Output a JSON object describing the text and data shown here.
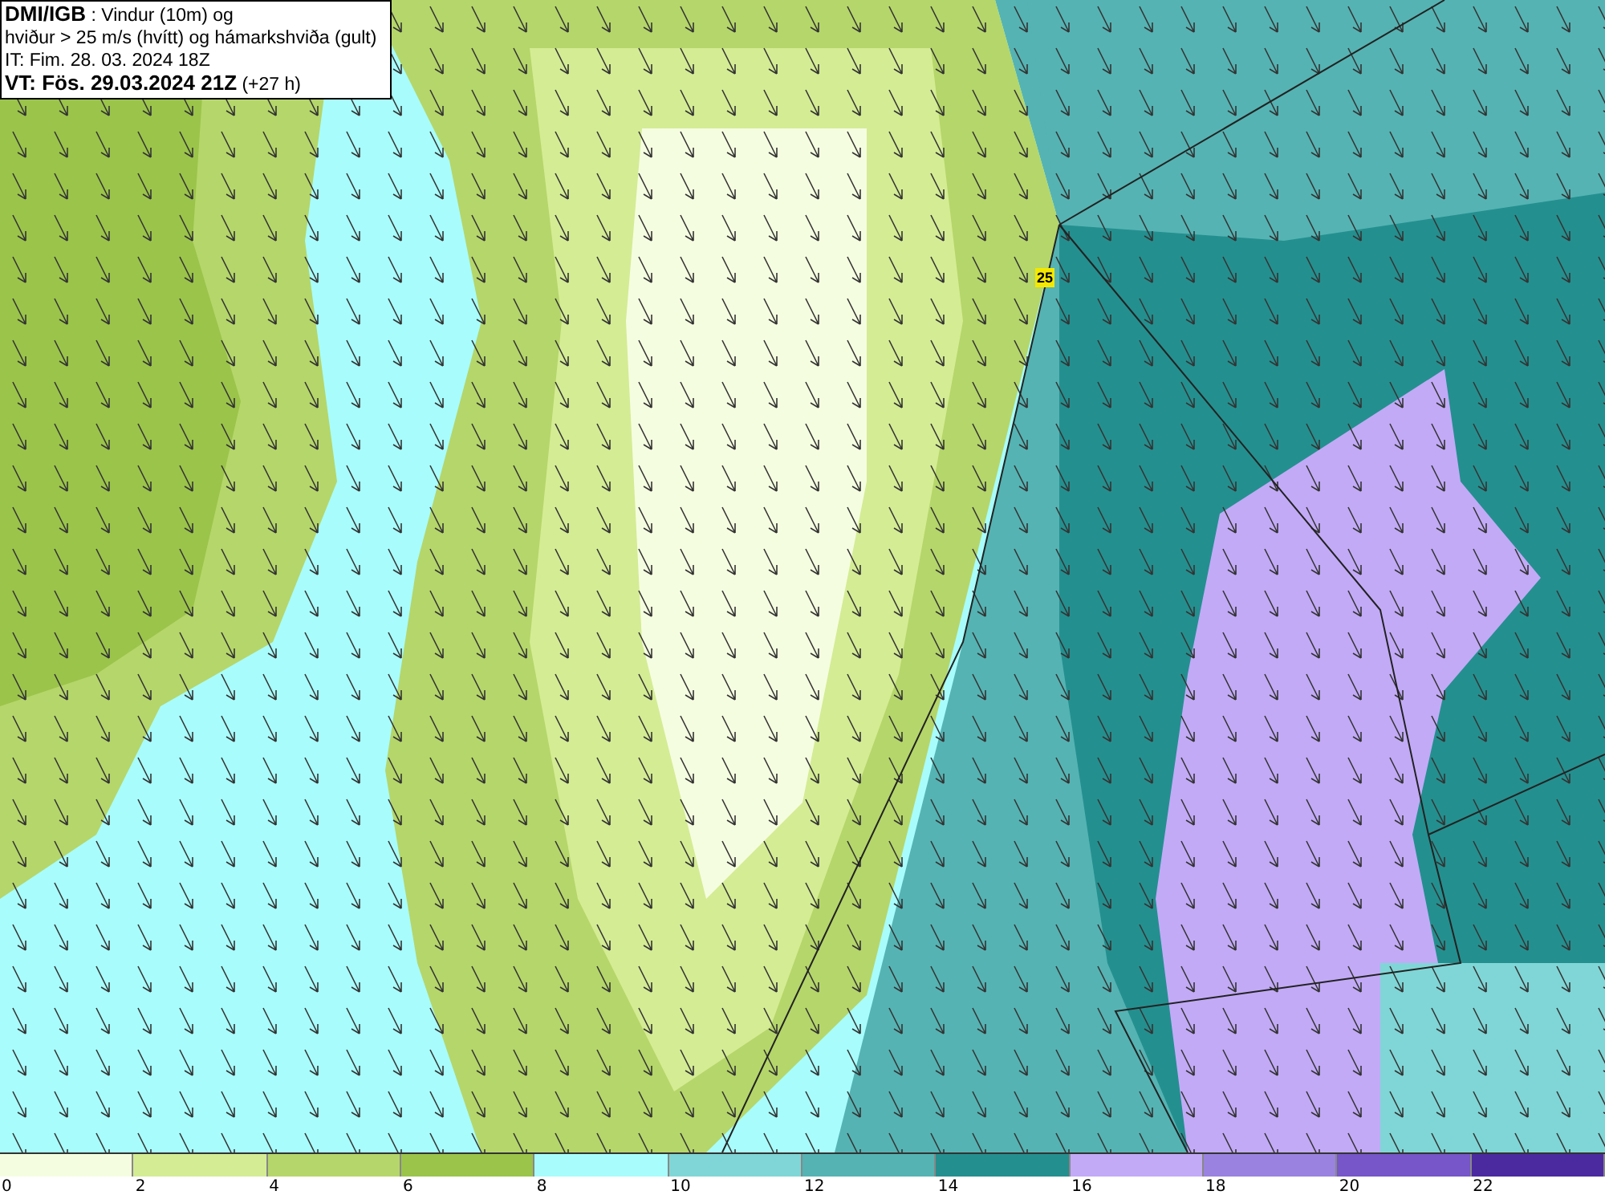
{
  "title_box": {
    "lines": [
      "**DMI/IGB** : Vindur (10m) og",
      "hviður > 25 m/s (hvítt) og hámarkshviða (gult)",
      "IT: Fim. 28. 03. 2024 18Z",
      "**VT: Fös. 29.03.2024 21Z** (+27 h)"
    ]
  },
  "gust_marker": {
    "label": "25"
  },
  "legend": {
    "bins": [
      {
        "label": "0",
        "color": "#f5fde0"
      },
      {
        "label": "2",
        "color": "#d4ec94"
      },
      {
        "label": "4",
        "color": "#b5d66a"
      },
      {
        "label": "6",
        "color": "#9bc44a"
      },
      {
        "label": "8",
        "color": "#a8fcfc"
      },
      {
        "label": "10",
        "color": "#80d6d6"
      },
      {
        "label": "12",
        "color": "#55b3b3"
      },
      {
        "label": "14",
        "color": "#248f8f"
      },
      {
        "label": "16",
        "color": "#c2aaf7"
      },
      {
        "label": "18",
        "color": "#9a82e0"
      },
      {
        "label": "20",
        "color": "#7656c8"
      },
      {
        "label": "22",
        "color": "#4b2aa0"
      }
    ]
  }
}
